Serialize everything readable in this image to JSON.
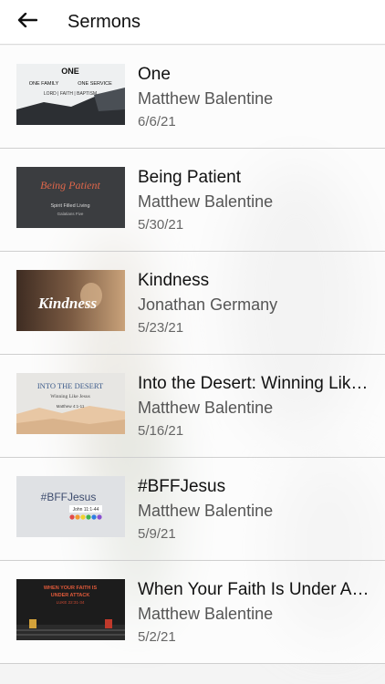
{
  "header": {
    "title": "Sermons",
    "back_icon": "arrow-left-icon"
  },
  "sermons": [
    {
      "title": "One",
      "speaker": "Matthew Balentine",
      "date": "6/6/21",
      "thumb": {
        "line1": "ONE",
        "line2": "ONE FAMILY",
        "line3": "ONE SERVICE",
        "line4": "LORD | FAITH | BAPTISM"
      }
    },
    {
      "title": "Being Patient",
      "speaker": "Matthew Balentine",
      "date": "5/30/21",
      "thumb": {
        "line1": "Being Patient",
        "line2": "Spirit Filled Living",
        "line3": "Galatians Five"
      }
    },
    {
      "title": "Kindness",
      "speaker": "Jonathan Germany",
      "date": "5/23/21",
      "thumb": {
        "line1": "Kindness"
      }
    },
    {
      "title": "Into the Desert: Winning Like Jesus",
      "speaker": "Matthew Balentine",
      "date": "5/16/21",
      "thumb": {
        "line1": "INTO THE DESERT",
        "line2": "Winning Like Jesus",
        "line3": "Matthew 4:1-11"
      }
    },
    {
      "title": "#BFFJesus",
      "speaker": "Matthew Balentine",
      "date": "5/9/21",
      "thumb": {
        "line1": "#BFFJesus",
        "line2": "John 11:1-44"
      }
    },
    {
      "title": "When Your Faith Is Under Attack",
      "speaker": "Matthew Balentine",
      "date": "5/2/21",
      "thumb": {
        "line1": "WHEN YOUR FAITH IS",
        "line2": "UNDER ATTACK",
        "line3": "LUKE 22:31-34"
      }
    }
  ]
}
